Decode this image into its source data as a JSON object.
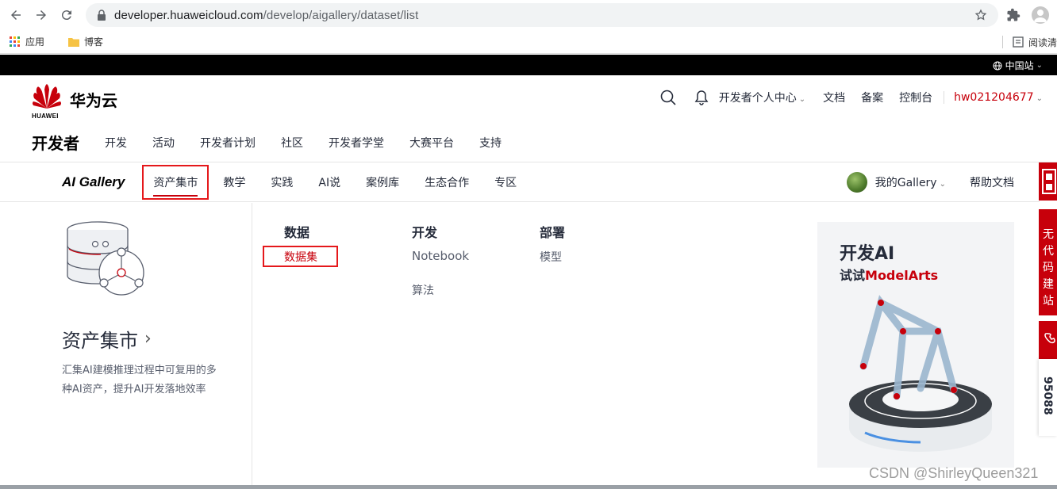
{
  "browser": {
    "url_host": "developer.huaweicloud.com",
    "url_path": "/develop/aigallery/dataset/list",
    "bookmarks": [
      {
        "label": "应用"
      },
      {
        "label": "博客"
      }
    ],
    "reading_list": "阅读清"
  },
  "topbar": {
    "region": "中国站"
  },
  "header": {
    "logo_word": "HUAWEI",
    "logo_text": "华为云",
    "dev_center": "开发者个人中心",
    "docs": "文档",
    "record": "备案",
    "console": "控制台",
    "username": "hw021204677"
  },
  "dev_nav": {
    "title": "开发者",
    "items": [
      "开发",
      "活动",
      "开发者计划",
      "社区",
      "开发者学堂",
      "大赛平台",
      "支持"
    ]
  },
  "gallery_nav": {
    "logo": "AI Gallery",
    "items": [
      "资产集市",
      "教学",
      "实践",
      "AI说",
      "案例库",
      "生态合作",
      "专区"
    ],
    "my_gallery": "我的Gallery",
    "help_docs": "帮助文档"
  },
  "mega": {
    "title": "资产集市",
    "description": "汇集AI建模推理过程中可复用的多种AI资产，提升AI开发落地效率",
    "columns": [
      {
        "head": "数据",
        "links": [
          "数据集"
        ]
      },
      {
        "head": "开发",
        "links": [
          "Notebook",
          "算法"
        ]
      },
      {
        "head": "部署",
        "links": [
          "模型"
        ]
      }
    ],
    "promo": {
      "line1": "开发AI",
      "line2_prefix": "试试",
      "line2_brand": "ModelArts"
    }
  },
  "side": {
    "red_text": "无代码建站",
    "phone_digits": "95088"
  },
  "watermark": "CSDN @ShirleyQueen321",
  "colors": {
    "brand_red": "#c7000b",
    "highlight_box": "#e5181b"
  }
}
